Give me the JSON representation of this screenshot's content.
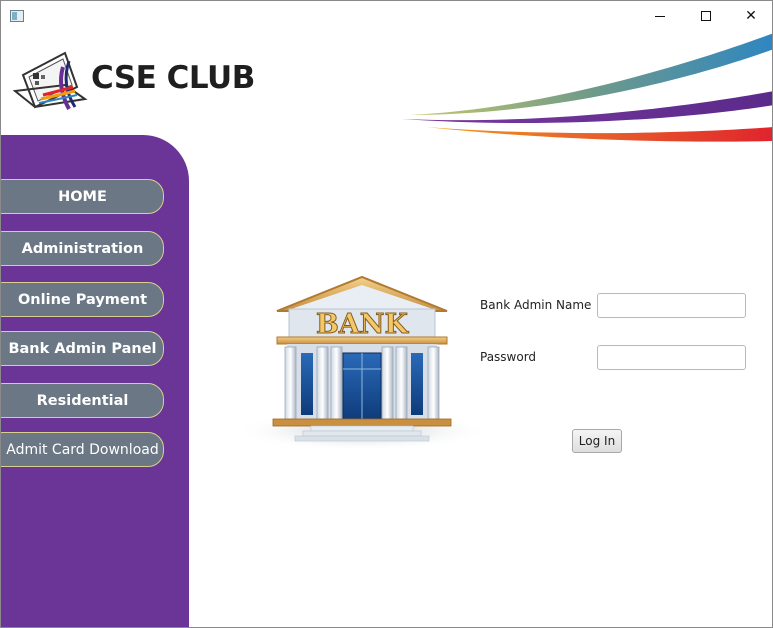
{
  "window": {
    "icons": {
      "app": "app-window-icon",
      "minimize": "minimize-icon",
      "maximize": "maximize-icon",
      "close": "close-icon"
    },
    "close_glyph": "✕"
  },
  "header": {
    "brand": "CSE CLUB",
    "logo_icon": "laptop-logo-icon",
    "swoosh_colors": [
      "#2e86c1",
      "#7a9a7a",
      "#6a2d93",
      "#e0242c",
      "#f39c12"
    ]
  },
  "sidebar": {
    "bg_color": "#6a3597",
    "button_color": "#6b7785",
    "button_border": "#d8d08c",
    "items": [
      {
        "label": "HOME"
      },
      {
        "label": "Administration"
      },
      {
        "label": "Online Payment"
      },
      {
        "label": "Bank Admin Panel"
      },
      {
        "label": "Residential"
      },
      {
        "label": "Admit Card Download"
      }
    ]
  },
  "main": {
    "bank_image": {
      "icon": "bank-building-icon",
      "sign_text": "BANK"
    },
    "form": {
      "username_label": "Bank Admin Name",
      "username_value": "",
      "password_label": "Password",
      "password_value": "",
      "submit_label": "Log In"
    }
  }
}
